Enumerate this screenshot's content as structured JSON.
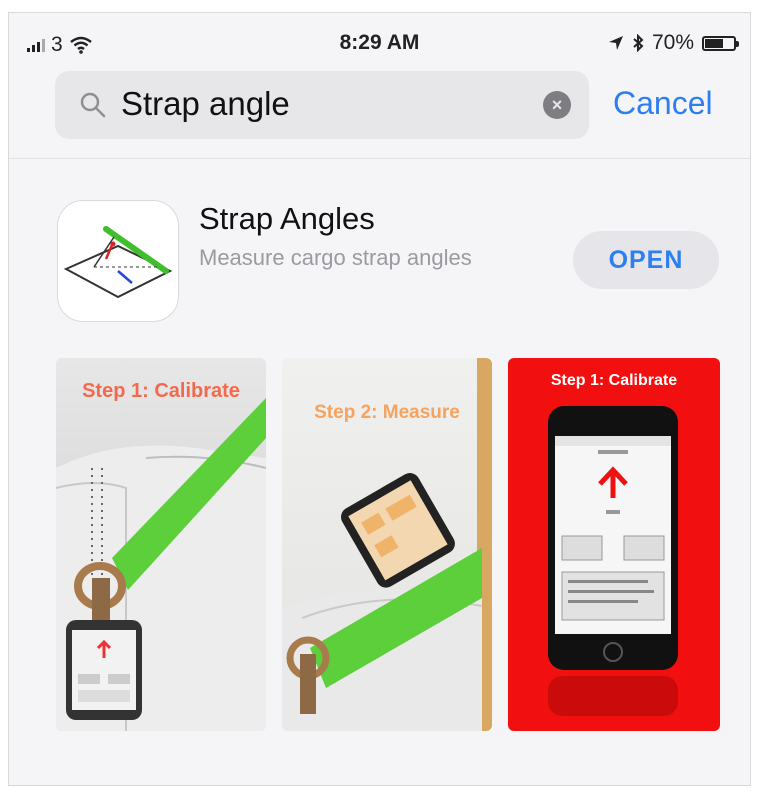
{
  "status_bar": {
    "carrier": "3",
    "time": "8:29 AM",
    "battery": "70%",
    "battery_level": 0.7
  },
  "search": {
    "query": "Strap angle",
    "cancel_label": "Cancel"
  },
  "app": {
    "title": "Strap Angles",
    "subtitle": "Measure cargo strap angles",
    "open_label": "OPEN"
  },
  "screenshots": [
    {
      "caption": "Step 1: Calibrate"
    },
    {
      "caption": "Step 2: Measure"
    },
    {
      "caption": "Step 1: Calibrate"
    }
  ],
  "colors": {
    "accent": "#2d7ff0",
    "strap_green": "#5ccf3a",
    "shot3_background": "#f20f0f"
  }
}
